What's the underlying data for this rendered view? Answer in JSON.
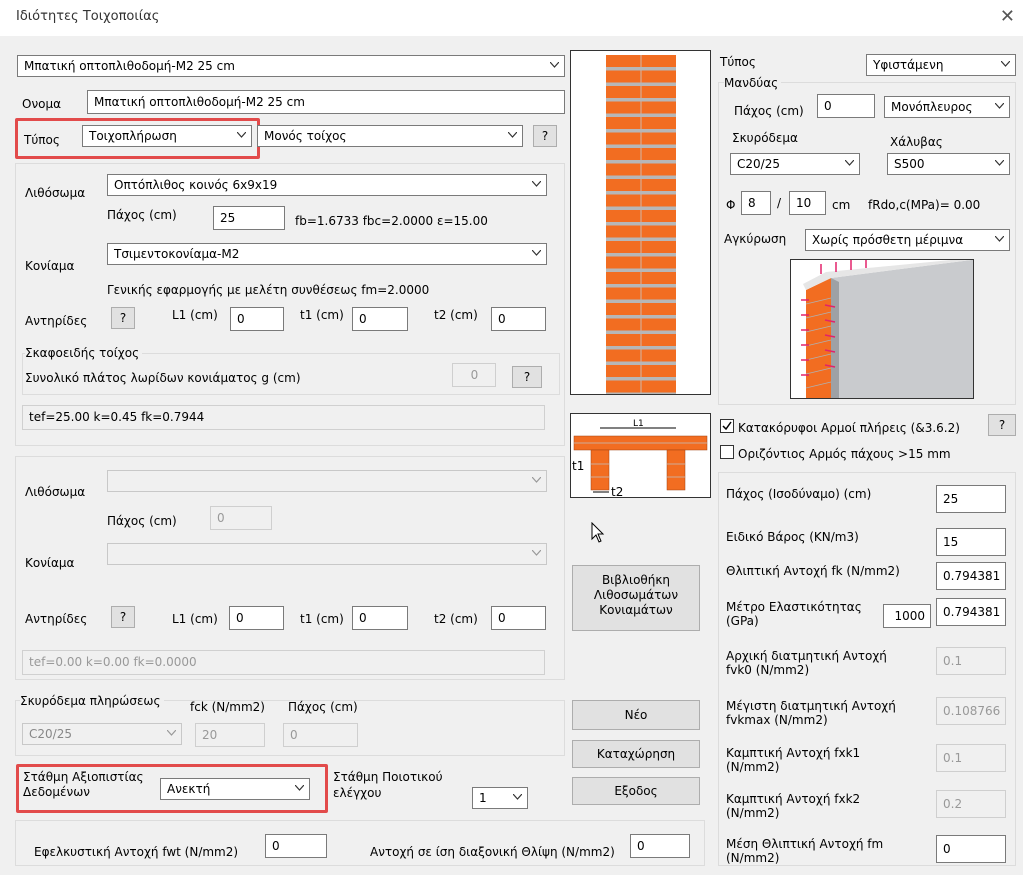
{
  "window": {
    "title": "Ιδιότητες Τοιχοποιίας"
  },
  "top": {
    "preset_value": "Μπατική οπτοπλιθοδομή-Μ2 25 cm",
    "name_label": "Ονομα",
    "name_value": "Μπατική οπτοπλιθοδομή-Μ2 25 cm",
    "type_label": "Τύπος",
    "type_value": "Τοιχοπλήρωση",
    "wall_kind_value": "Μονός τοίχος",
    "help": "?"
  },
  "layer1": {
    "block_label": "Λιθόσωμα",
    "block_value": "Οπτόπλιθος κοινός 6x9x19",
    "thickness_label": "Πάχος (cm)",
    "thickness_value": "25",
    "fb_text": "fb=1.6733 fbc=2.0000 ε=15.00",
    "mortar_label": "Κονίαμα",
    "mortar_value": "Τσιμεντοκονίαμα-Μ2",
    "mortar_note": "Γενικής εφαρμογής με μελέτη συνθέσεως fm=2.0000",
    "piers_label": "Αντηρίδες",
    "piers_help": "?",
    "l1_label": "L1 (cm)",
    "l1_value": "0",
    "t1_label": "t1 (cm)",
    "t1_value": "0",
    "t2_label": "t2 (cm)",
    "t2_value": "0",
    "cavity_title": "Σκαφοειδής τοίχος",
    "cavity_label": "Συνολικό πλάτος λωρίδων κονιάματος g (cm)",
    "cavity_value": "0",
    "cavity_help": "?",
    "result": "tef=25.00 k=0.45 fk=0.7944"
  },
  "layer2": {
    "block_label": "Λιθόσωμα",
    "thickness_label": "Πάχος (cm)",
    "thickness_value": "0",
    "mortar_label": "Κονίαμα",
    "piers_label": "Αντηρίδες",
    "piers_help": "?",
    "l1_label": "L1 (cm)",
    "l1_value": "0",
    "t1_label": "t1 (cm)",
    "t1_value": "0",
    "t2_label": "t2 (cm)",
    "t2_value": "0",
    "result": "tef=0.00 k=0.00 fk=0.0000"
  },
  "infill": {
    "title": "Σκυρόδεμα πληρώσεως",
    "fck_label": "fck (N/mm2)",
    "thickness_label": "Πάχος (cm)",
    "concrete_value": "C20/25",
    "fck_value": "20",
    "thickness_value": "0"
  },
  "reliability": {
    "label_line1": "Στάθμη Αξιοπιστίας",
    "label_line2": "Δεδομένων",
    "value": "Ανεκτή",
    "quality_line1": "Στάθμη Ποιοτικού",
    "quality_line2": "ελέγχου",
    "quality_value": "1"
  },
  "bottom": {
    "fwt_label": "Εφελκυστική Αντοχή fwt (N/mm2)",
    "fwt_value": "0",
    "diag_label": "Αντοχή σε ίση διαξονική Θλίψη (N/mm2)",
    "diag_value": "0"
  },
  "middle": {
    "library_line1": "Βιβλιοθήκη",
    "library_line2": "Λιθοσωμάτων",
    "library_line3": "Κονιαμάτων",
    "new_button": "Νέο",
    "save_button": "Καταχώρηση",
    "exit_button": "Εξοδος",
    "diagram_l1": "L1",
    "diagram_t1": "t1",
    "diagram_t2": "t2"
  },
  "right": {
    "type_label": "Τύπος",
    "type_value": "Υφιστάμενη",
    "jacket_title": "Μανδύας",
    "thickness_label": "Πάχος (cm)",
    "thickness_value": "0",
    "side_value": "Μονόπλευρος",
    "concrete_label": "Σκυρόδεμα",
    "concrete_value": "C20/25",
    "steel_label": "Χάλυβας",
    "steel_value": "S500",
    "phi_label": "Φ",
    "phi_value": "8",
    "slash": "/",
    "spacing_value": "10",
    "cm_label": "cm",
    "frdo_text": "fRdo,c(MPa)= 0.00",
    "anchor_label": "Αγκύρωση",
    "anchor_value": "Χωρίς πρόσθετη μέριμνα",
    "vertical_joints": "Κατακόρυφοι Αρμοί πλήρεις (&3.6.2)",
    "vertical_checked": true,
    "horizontal_joint": "Οριζόντιος Αρμός πάχους >15 mm",
    "help": "?",
    "props": [
      {
        "label": "Πάχος (Ισοδύναμο) (cm)",
        "value": "25"
      },
      {
        "label": "Ειδικό Βάρος (KN/m3)",
        "value": "15"
      },
      {
        "label": "Θλιπτική Αντοχή fk (N/mm2)",
        "value": "0.794381"
      },
      {
        "label": "Μέτρο Ελαστικότητας (GPa)",
        "value": "0.794381",
        "extra": "1000"
      },
      {
        "label": "Αρχική διατμητική Αντοχή fvk0 (N/mm2)",
        "value": "0.1"
      },
      {
        "label": "Μέγιστη διατμητική Αντοχή fvkmax (N/mm2)",
        "value": "0.108766"
      },
      {
        "label": "Καμπτική Αντοχή  fxk1 (N/mm2)",
        "value": "0.1"
      },
      {
        "label": "Καμπτική Αντοχή  fxk2 (N/mm2)",
        "value": "0.2"
      },
      {
        "label": "Μέση Θλιπτική Αντοχή fm (N/mm2)",
        "value": "0"
      }
    ]
  },
  "colors": {
    "brick": "#f26d21",
    "mortar": "#b7b7b7",
    "highlight": "#e24b4b"
  }
}
